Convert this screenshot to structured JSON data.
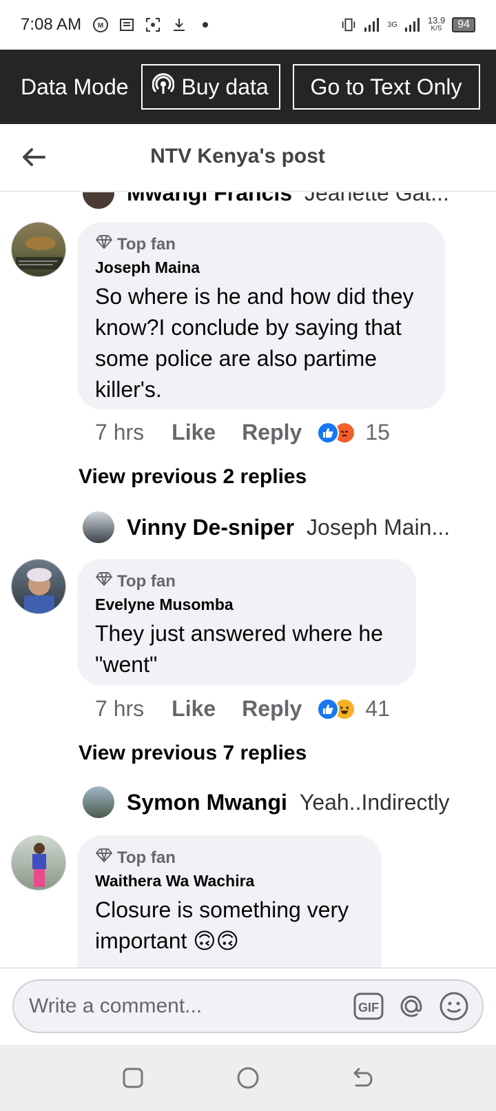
{
  "status_bar": {
    "time": "7:08 AM",
    "network_type": "3G",
    "speed_value": "13.9",
    "speed_unit": "K/S",
    "battery": "94"
  },
  "data_bar": {
    "mode_label": "Data Mode",
    "buy_label": "Buy data",
    "text_only_label": "Go to Text Only"
  },
  "header": {
    "title": "NTV Kenya's post"
  },
  "feed": {
    "top_reply": {
      "name": "Mwangi Francis",
      "text": "Jeanette Gat..."
    },
    "comments": [
      {
        "badge": "Top fan",
        "author": "Joseph Maina",
        "text": "So where is he and how did they know?I conclude by saying that some police are also partime killer's.",
        "time": "7 hrs",
        "like": "Like",
        "reply": "Reply",
        "reaction_count": "15",
        "reactions": [
          "like-icon",
          "angry-icon"
        ],
        "view_previous": "View previous 2 replies",
        "latest_reply": {
          "name": "Vinny De-sniper",
          "text": "Joseph Main..."
        }
      },
      {
        "badge": "Top fan",
        "author": "Evelyne Musomba",
        "text": "They just answered where he \"went\"",
        "time": "7 hrs",
        "like": "Like",
        "reply": "Reply",
        "reaction_count": "41",
        "reactions": [
          "like-icon",
          "haha-icon"
        ],
        "view_previous": "View previous 7 replies",
        "latest_reply": {
          "name": "Symon Mwangi",
          "text": "Yeah..Indirectly"
        }
      },
      {
        "badge": "Top fan",
        "author": "Waithera Wa Wachira",
        "text": "Closure is something very important 🙃🙃"
      }
    ]
  },
  "composer": {
    "placeholder": "Write a comment...",
    "gif_label": "GIF"
  },
  "colors": {
    "data_bar_bg": "#242526",
    "bubble_bg": "#f0f2f5",
    "like_blue": "#1877f2",
    "muted_text": "#65676b"
  }
}
